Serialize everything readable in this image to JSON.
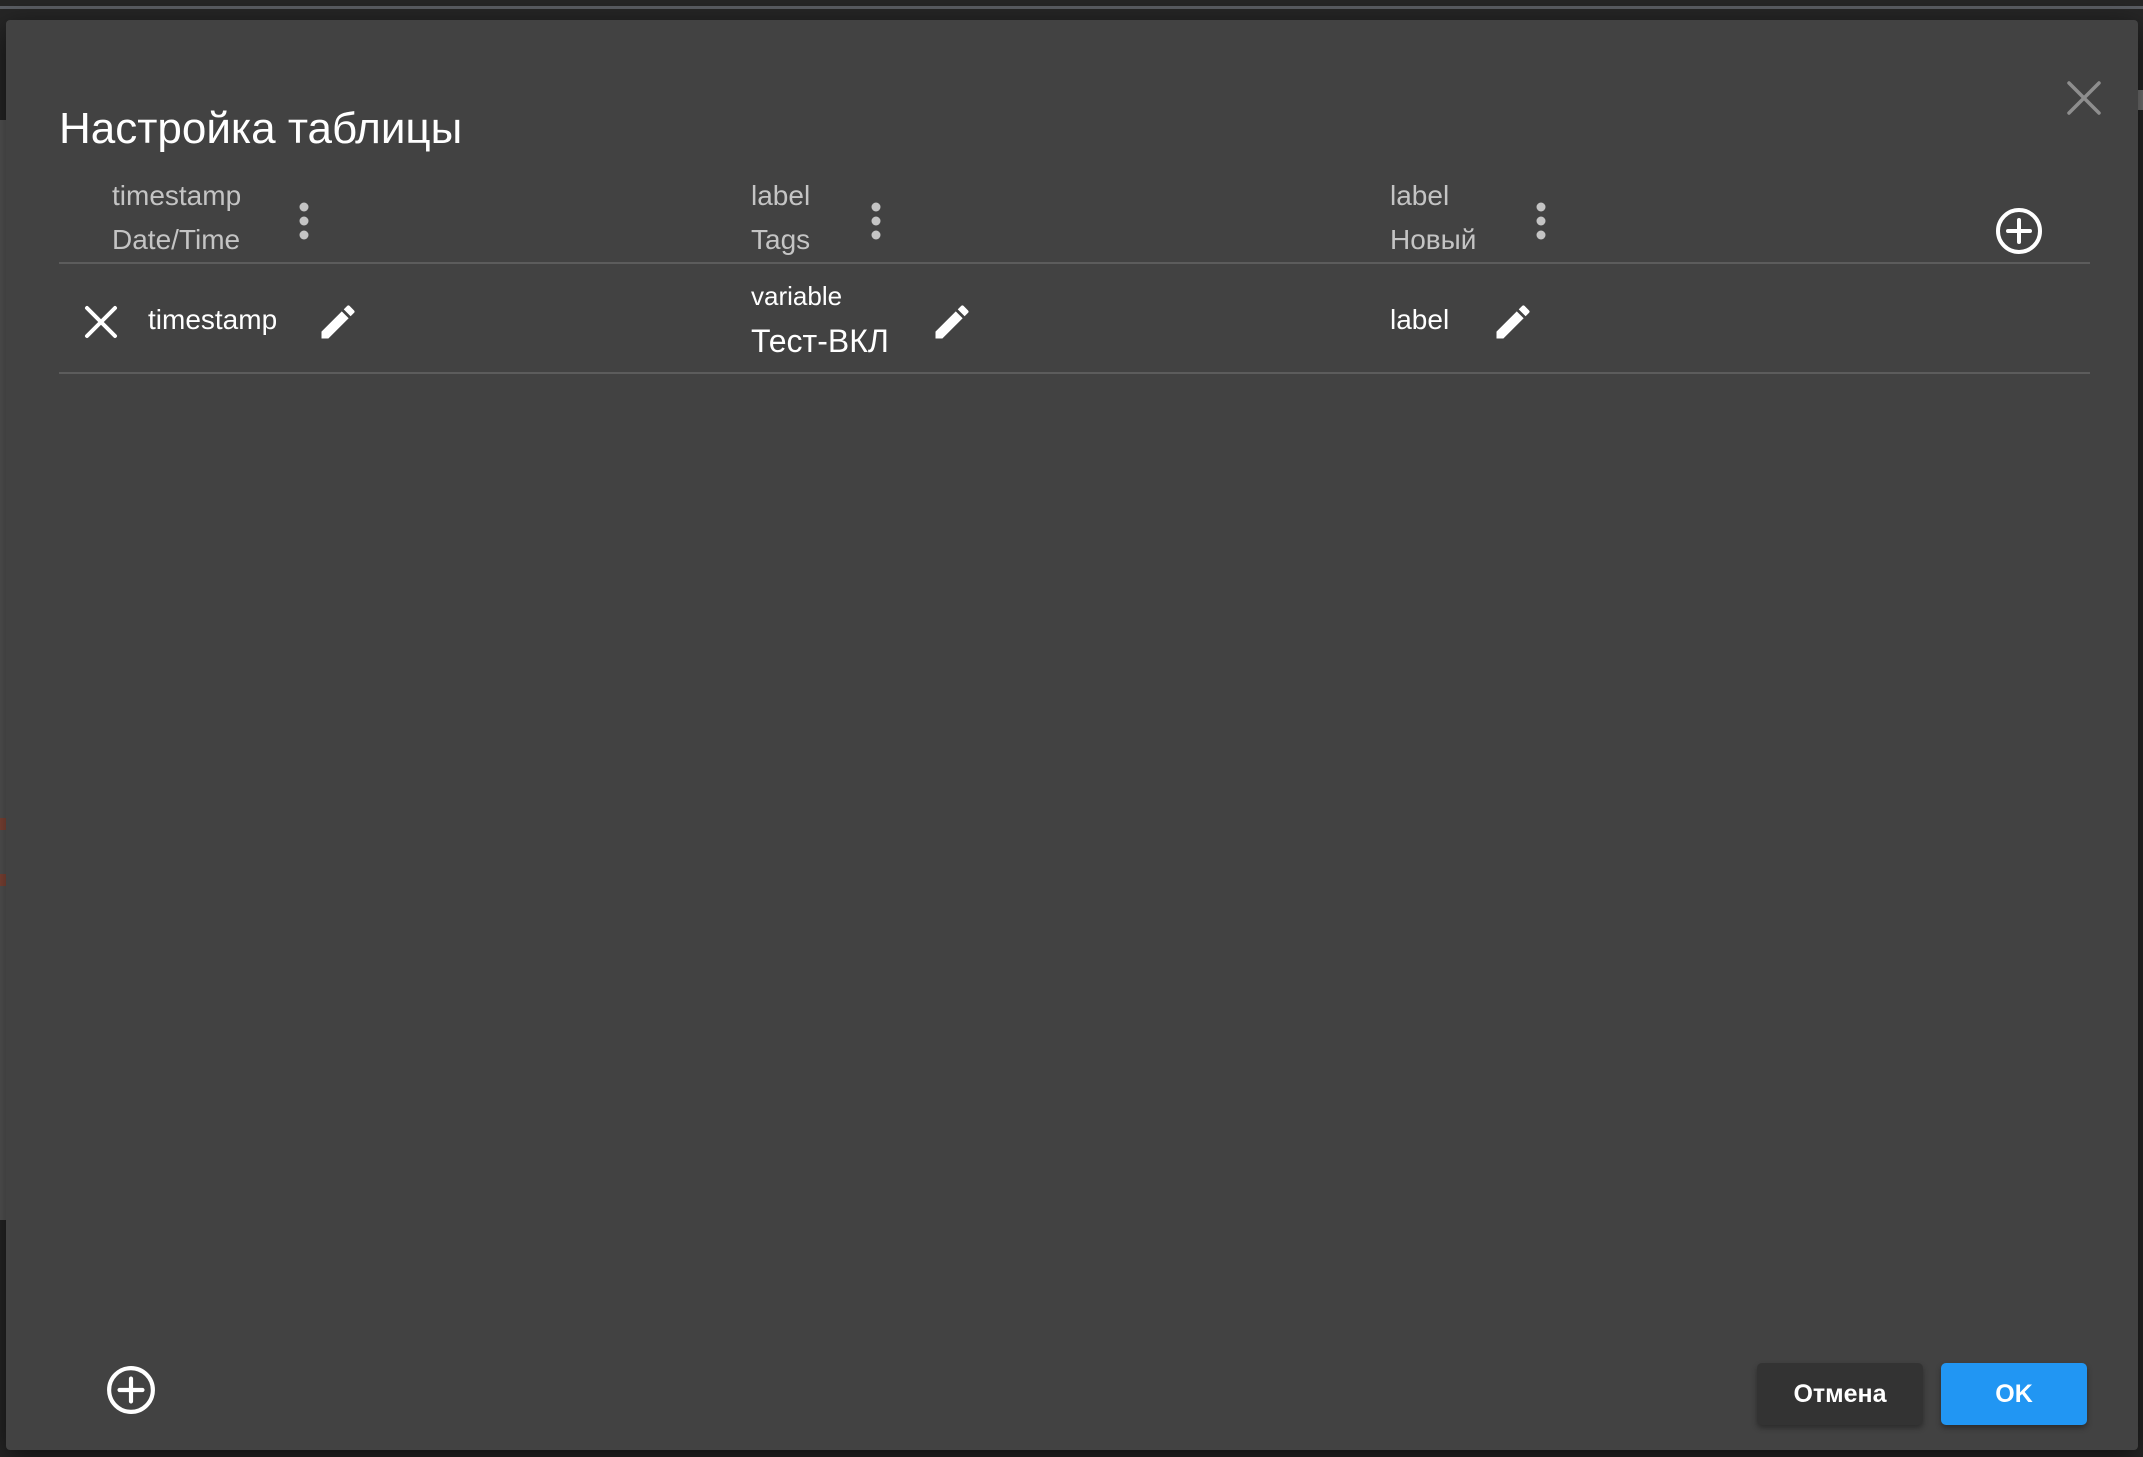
{
  "dialog": {
    "title": "Настройка таблицы"
  },
  "columns": [
    {
      "field": "timestamp",
      "header": "Date/Time"
    },
    {
      "field": "label",
      "header": "Tags"
    },
    {
      "field": "label",
      "header": "Новый"
    }
  ],
  "row": {
    "cells": [
      {
        "value": "timestamp"
      },
      {
        "type": "variable",
        "value": "Тест-ВКЛ"
      },
      {
        "value": "label"
      }
    ]
  },
  "footer": {
    "cancel_label": "Отмена",
    "ok_label": "OK"
  },
  "colors": {
    "dialog_bg": "#424242",
    "accent": "#2196f3",
    "divider": "#5c5c5c"
  },
  "icons": {
    "close": "close-icon",
    "column_menu": "more-vert-icon",
    "add": "add-circle-icon",
    "delete_row": "close-icon",
    "edit": "pencil-icon"
  }
}
